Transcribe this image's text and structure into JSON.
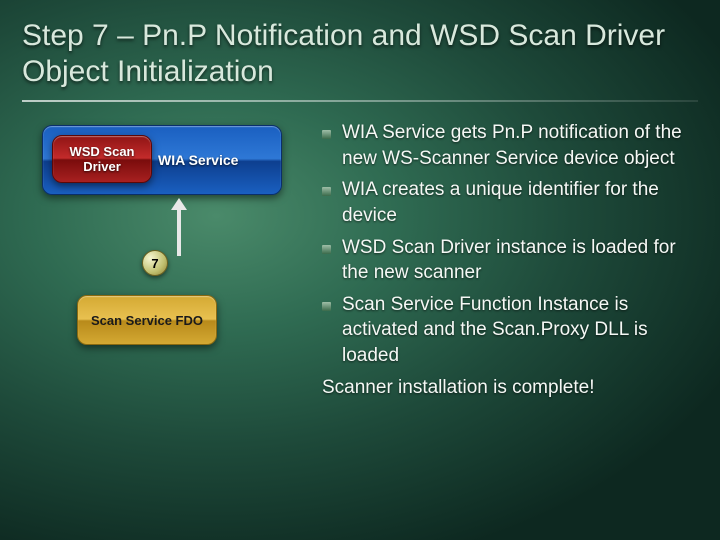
{
  "title": "Step 7 – Pn.P Notification and WSD Scan Driver Object Initialization",
  "diagram": {
    "wsd_label": "WSD Scan Driver",
    "wia_label": "WIA Service",
    "step_number": "7",
    "fdo_label": "Scan Service FDO"
  },
  "bullets": [
    "WIA Service gets Pn.P notification of the new WS-Scanner Service device object",
    "WIA creates a unique identifier for the device",
    "WSD Scan Driver instance is loaded for the new scanner",
    "Scan Service Function Instance is activated and the Scan.Proxy DLL is loaded"
  ],
  "closing": "Scanner installation is complete!"
}
